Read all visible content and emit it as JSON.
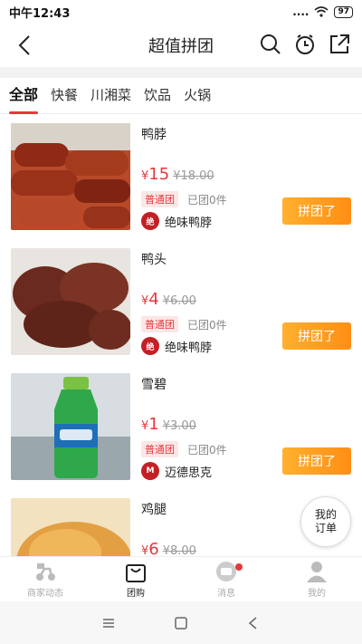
{
  "status": {
    "time": "中午12:43",
    "signal": "....",
    "battery": "97"
  },
  "header": {
    "title": "超值拼团"
  },
  "tabs": [
    {
      "label": "全部",
      "active": true
    },
    {
      "label": "快餐"
    },
    {
      "label": "川湘菜"
    },
    {
      "label": "饮品"
    },
    {
      "label": "火锅"
    }
  ],
  "items": [
    {
      "name": "鸭脖",
      "price_symbol": "¥",
      "price": "15",
      "orig_price": "¥18.00",
      "tag": "普通团",
      "joined": "已团0件",
      "shop_name": "绝味鸭脖",
      "shop_logo": "绝",
      "button": "拼团了",
      "thumb": "duck-neck-photo"
    },
    {
      "name": "鸭头",
      "price_symbol": "¥",
      "price": "4",
      "orig_price": "¥6.00",
      "tag": "普通团",
      "joined": "已团0件",
      "shop_name": "绝味鸭脖",
      "shop_logo": "绝",
      "button": "拼团了",
      "thumb": "duck-head-photo"
    },
    {
      "name": "雪碧",
      "price_symbol": "¥",
      "price": "1",
      "orig_price": "¥3.00",
      "tag": "普通团",
      "joined": "已团0件",
      "shop_name": "迈德思克",
      "shop_logo": "M",
      "button": "拼团了",
      "thumb": "sprite-bottle-photo"
    },
    {
      "name": "鸡腿",
      "price_symbol": "¥",
      "price": "6",
      "orig_price": "¥8.00",
      "thumb": "chicken-leg-photo"
    }
  ],
  "float_button": {
    "line1": "我的",
    "line2": "订单"
  },
  "tabbar": [
    {
      "label": "商家动态",
      "icon": "scooter-icon"
    },
    {
      "label": "团购",
      "icon": "bag-icon",
      "active": true
    },
    {
      "label": "消息",
      "icon": "message-icon",
      "badge": true
    },
    {
      "label": "我的",
      "icon": "person-icon"
    }
  ],
  "colors": {
    "accent": "#e4393c",
    "button": "#ff9a1f"
  }
}
